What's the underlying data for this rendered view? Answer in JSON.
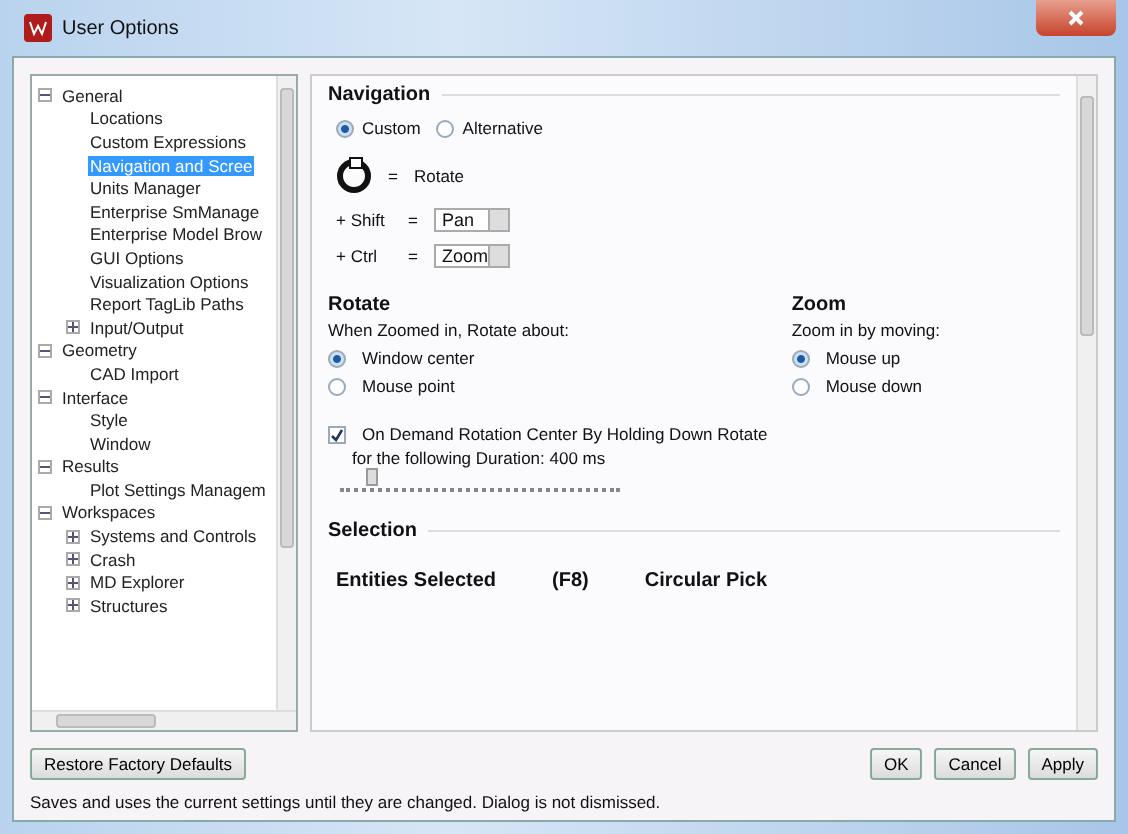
{
  "window": {
    "title": "User Options"
  },
  "tree": [
    {
      "label": "General",
      "expanded": true,
      "selected": false,
      "children": [
        {
          "label": "Locations",
          "selected": false
        },
        {
          "label": "Custom Expressions",
          "selected": false
        },
        {
          "label": "Navigation and Scree",
          "selected": true
        },
        {
          "label": "Units Manager",
          "selected": false
        },
        {
          "label": "Enterprise SmManage",
          "selected": false
        },
        {
          "label": "Enterprise Model Brow",
          "selected": false
        },
        {
          "label": "GUI Options",
          "selected": false
        },
        {
          "label": "Visualization Options",
          "selected": false
        },
        {
          "label": "Report TagLib Paths",
          "selected": false
        },
        {
          "label": "Input/Output",
          "selected": false,
          "expanded": false
        }
      ]
    },
    {
      "label": "Geometry",
      "expanded": true,
      "selected": false,
      "children": [
        {
          "label": "CAD Import",
          "selected": false
        }
      ]
    },
    {
      "label": "Interface",
      "expanded": true,
      "selected": false,
      "children": [
        {
          "label": "Style",
          "selected": false
        },
        {
          "label": "Window",
          "selected": false
        }
      ]
    },
    {
      "label": "Results",
      "expanded": true,
      "selected": false,
      "children": [
        {
          "label": "Plot Settings Managem",
          "selected": false
        }
      ]
    },
    {
      "label": "Workspaces",
      "expanded": true,
      "selected": false,
      "children": [
        {
          "label": "Systems and Controls",
          "selected": false,
          "expanded": false
        },
        {
          "label": "Crash",
          "selected": false,
          "expanded": false
        },
        {
          "label": "MD Explorer",
          "selected": false,
          "expanded": false
        },
        {
          "label": "Structures",
          "selected": false,
          "expanded": false
        }
      ]
    }
  ],
  "navigation": {
    "title": "Navigation",
    "modes": [
      {
        "label": "Custom",
        "selected": true
      },
      {
        "label": "Alternative",
        "selected": false
      }
    ],
    "mouse_action": {
      "sign": "=",
      "action": "Rotate"
    },
    "bindings": [
      {
        "key": "+ Shift",
        "sign": "=",
        "value": "Pan"
      },
      {
        "key": "+ Ctrl",
        "sign": "=",
        "value": "Zoom"
      }
    ]
  },
  "rotate": {
    "title": "Rotate",
    "caption": "When Zoomed in, Rotate about:",
    "options": [
      {
        "label": "Window center",
        "selected": true
      },
      {
        "label": "Mouse point",
        "selected": false
      }
    ]
  },
  "zoom": {
    "title": "Zoom",
    "caption": "Zoom in by moving:",
    "options": [
      {
        "label": "Mouse up",
        "selected": true
      },
      {
        "label": "Mouse down",
        "selected": false
      }
    ]
  },
  "on_demand": {
    "label": "On Demand Rotation Center By Holding Down Rotate",
    "checked": true,
    "duration": "for the following Duration: 400 ms",
    "level": 0.1
  },
  "selection": {
    "title": "Selection",
    "columns": [
      "Entities Selected",
      "(F8)",
      "Circular Pick"
    ]
  },
  "restore_button": "Restore Factory Defaults",
  "buttons": [
    "OK",
    "Cancel",
    "Apply"
  ],
  "status_bar": "Saves and uses the current settings until they are changed. Dialog is not dismissed."
}
